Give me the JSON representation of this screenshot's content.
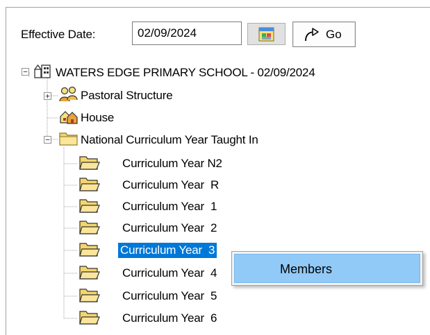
{
  "toolbar": {
    "effective_date_label": "Effective Date:",
    "effective_date_value": "02/09/2024",
    "calendar_icon": "calendar-icon",
    "go_label": "Go",
    "go_icon": "redo-arrow-icon"
  },
  "tree": {
    "root": {
      "label": "WATERS EDGE PRIMARY SCHOOL - 02/09/2024",
      "icon": "school-icon",
      "expanded": true
    },
    "nodes": [
      {
        "label": "Pastoral Structure",
        "icon": "group-icon",
        "expander": "+"
      },
      {
        "label": "House",
        "icon": "house-group-icon"
      },
      {
        "label": "National Curriculum Year Taught In",
        "icon": "folder-icon",
        "expander": "-"
      }
    ],
    "years": [
      {
        "label": "Curriculum Year N2"
      },
      {
        "label": "Curriculum Year  R"
      },
      {
        "label": "Curriculum Year  1"
      },
      {
        "label": "Curriculum Year  2"
      },
      {
        "label": "Curriculum Year  3",
        "selected": true
      },
      {
        "label": "Curriculum Year  4"
      },
      {
        "label": "Curriculum Year  5"
      },
      {
        "label": "Curriculum Year  6"
      }
    ]
  },
  "context_menu": {
    "items": [
      {
        "label": "Members",
        "highlighted": true
      }
    ]
  },
  "colors": {
    "selection": "#0078d7",
    "menu_highlight": "#91c9f7",
    "folder": "#f5d66b"
  }
}
